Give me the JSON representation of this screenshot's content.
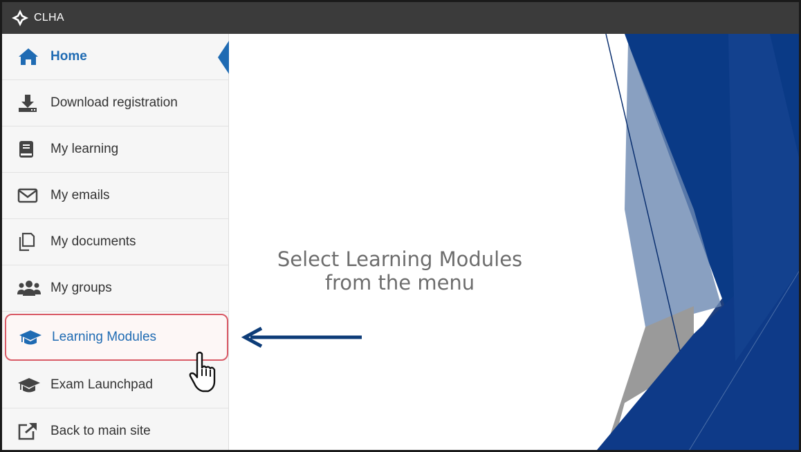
{
  "app": {
    "title": "CLHA",
    "logo_icon": "diamond-star-logo"
  },
  "sidebar": {
    "items": [
      {
        "label": "Home",
        "icon": "home-icon",
        "active": true
      },
      {
        "label": "Download registration",
        "icon": "download-icon"
      },
      {
        "label": "My learning",
        "icon": "book-icon"
      },
      {
        "label": "My emails",
        "icon": "envelope-icon"
      },
      {
        "label": "My documents",
        "icon": "documents-icon"
      },
      {
        "label": "My groups",
        "icon": "group-icon"
      },
      {
        "label": "Learning Modules",
        "icon": "graduation-cap-icon",
        "highlighted": true
      },
      {
        "label": "Exam Launchpad",
        "icon": "graduation-cap-icon"
      },
      {
        "label": "Back to main site",
        "icon": "external-link-icon"
      }
    ]
  },
  "instruction": {
    "text": "Select Learning Modules from the menu"
  },
  "colors": {
    "topbar": "#3b3b3b",
    "accent_blue": "#1f6bb3",
    "arrow_blue": "#0d3c78",
    "highlight_border": "#d95a66",
    "deco_dark_blue": "#0a2f6f"
  }
}
